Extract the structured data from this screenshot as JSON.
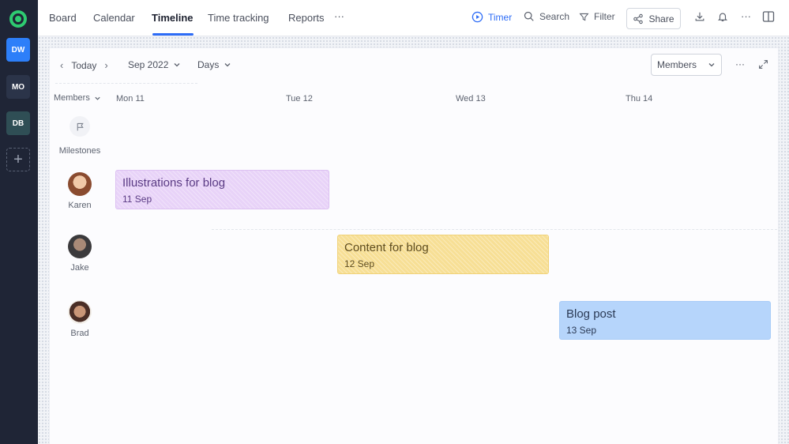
{
  "rail": {
    "workspaces": [
      {
        "label": "DW",
        "color": "#2d7ff9"
      },
      {
        "label": "MO",
        "color": "#2b3449"
      },
      {
        "label": "DB",
        "color": "#2f4e55"
      }
    ],
    "add_label": "+"
  },
  "nav": {
    "tabs": [
      "Board",
      "Calendar",
      "Timeline",
      "Time tracking",
      "Reports"
    ],
    "active_tab": "Timeline",
    "more": "···",
    "timer": "Timer",
    "search": "Search",
    "filter": "Filter",
    "share": "Share",
    "overflow": "···"
  },
  "toolbar": {
    "today": "Today",
    "month": "Sep 2022",
    "scale": "Days",
    "members_dropdown": "Members",
    "more": "···"
  },
  "grid": {
    "row_header": "Members",
    "days": [
      "Mon 11",
      "Tue 12",
      "Wed 13",
      "Thu 14"
    ],
    "milestones_label": "Milestones"
  },
  "members": [
    {
      "name": "Karen"
    },
    {
      "name": "Jake"
    },
    {
      "name": "Brad"
    }
  ],
  "tasks": [
    {
      "title": "Illustrations for blog",
      "date": "11 Sep",
      "color": "#e8d3f8"
    },
    {
      "title": "Content for blog",
      "date": "12 Sep",
      "color": "#f7df95"
    },
    {
      "title": "Blog post",
      "date": "13 Sep",
      "color": "#b6d5fb"
    }
  ]
}
